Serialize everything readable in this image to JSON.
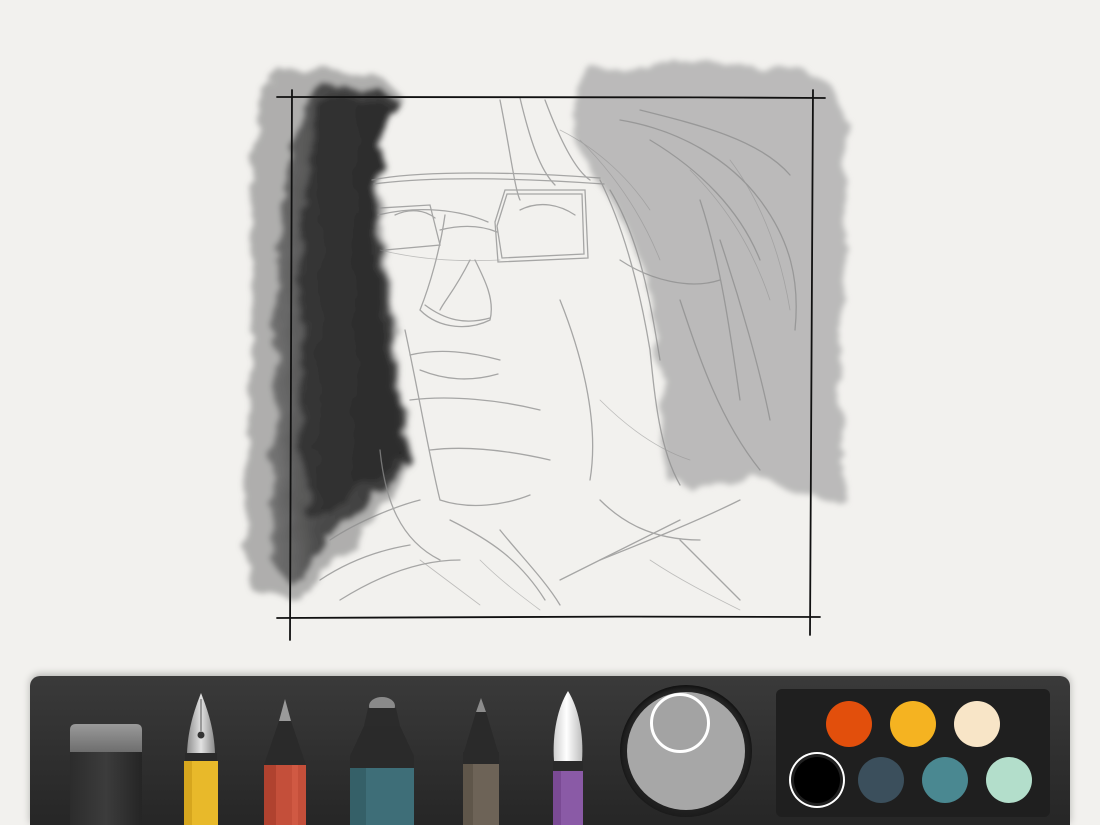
{
  "canvas": {
    "subject": "pencil-sketch-portrait",
    "paper_color": "#f2f1ee"
  },
  "toolbar": {
    "tools": [
      {
        "name": "eraser",
        "icon": "eraser-icon"
      },
      {
        "name": "draw",
        "icon": "fountain-pen-icon",
        "color": "#e8b92a"
      },
      {
        "name": "sketch",
        "icon": "pencil-icon",
        "color": "#c44f3a"
      },
      {
        "name": "outline",
        "icon": "marker-icon",
        "color": "#3e6e78"
      },
      {
        "name": "write",
        "icon": "pen-icon",
        "color": "#6d6357"
      },
      {
        "name": "color",
        "icon": "brush-icon",
        "color": "#8a5aa6"
      }
    ],
    "mixer": {
      "current_color": "#a3a3a3"
    },
    "palette": {
      "swatches": [
        {
          "color": "#e24f0c"
        },
        {
          "color": "#f5b321"
        },
        {
          "color": "#f8e5c7"
        },
        {
          "color": "#000000",
          "selected": true
        },
        {
          "color": "#3b4f5c"
        },
        {
          "color": "#4a8891"
        },
        {
          "color": "#b3decb"
        }
      ]
    }
  }
}
